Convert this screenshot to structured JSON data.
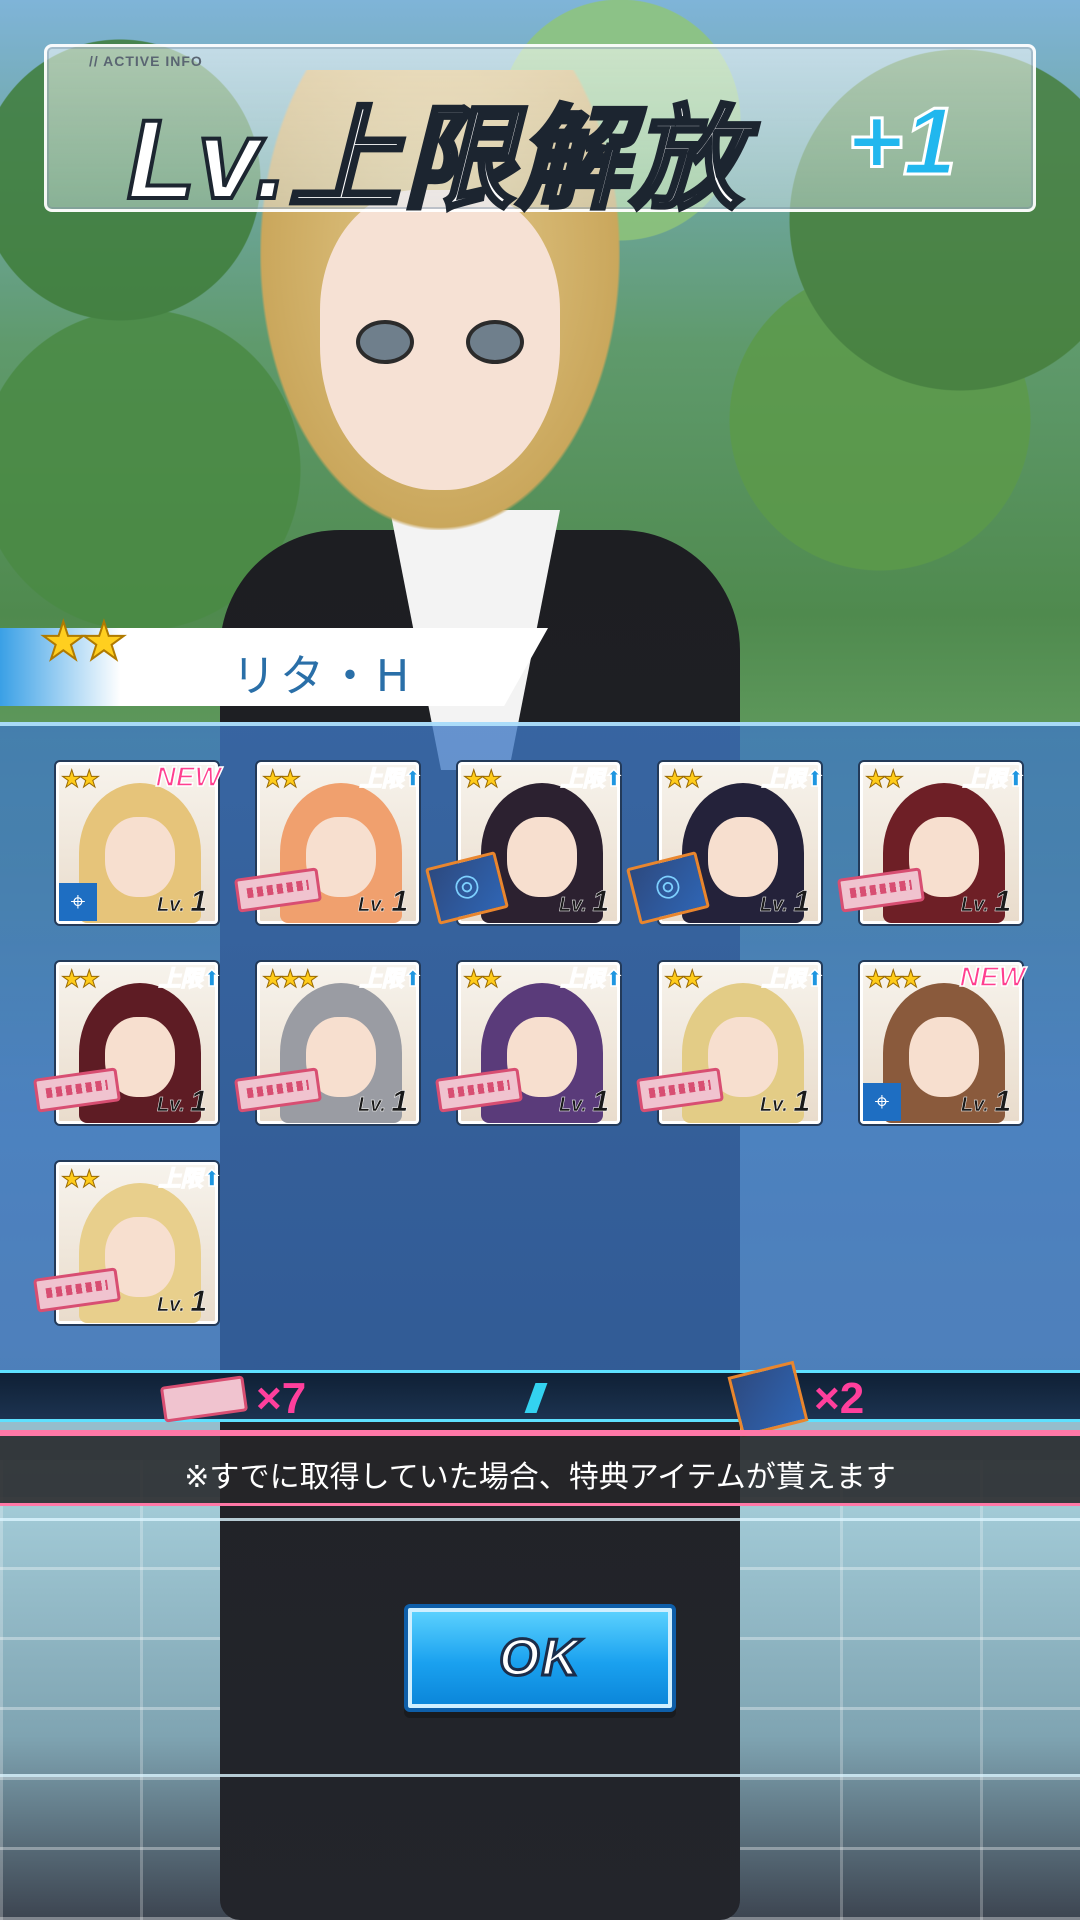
{
  "title": {
    "small_label": "// ACTIVE INFO",
    "main": "Lv.上限解放",
    "plus": "+1"
  },
  "character": {
    "name": "リタ・H",
    "stars": "★★"
  },
  "cards": [
    {
      "stars": "★★",
      "badge": "NEW",
      "badge_type": "new",
      "level_prefix": "Lv.",
      "level": "1",
      "item": "side-icon",
      "hair": "#e6c47a"
    },
    {
      "stars": "★★",
      "badge": "上限⬆",
      "badge_type": "up",
      "level_prefix": "Lv.",
      "level": "1",
      "item": "ticket",
      "hair": "#f0a06e"
    },
    {
      "stars": "★★",
      "badge": "上限⬆",
      "badge_type": "up",
      "level_prefix": "Lv.",
      "level": "1",
      "item": "book",
      "hair": "#2c2130"
    },
    {
      "stars": "★★",
      "badge": "上限⬆",
      "badge_type": "up",
      "level_prefix": "Lv.",
      "level": "1",
      "item": "book",
      "hair": "#24223a"
    },
    {
      "stars": "★★",
      "badge": "上限⬆",
      "badge_type": "up",
      "level_prefix": "Lv.",
      "level": "1",
      "item": "ticket",
      "hair": "#6e1f26"
    },
    {
      "stars": "★★",
      "badge": "上限⬆",
      "badge_type": "up",
      "level_prefix": "Lv.",
      "level": "1",
      "item": "ticket",
      "hair": "#5e1c24"
    },
    {
      "stars": "★★★",
      "badge": "上限⬆",
      "badge_type": "up",
      "level_prefix": "Lv.",
      "level": "1",
      "item": "ticket",
      "hair": "#9a9ca3"
    },
    {
      "stars": "★★",
      "badge": "上限⬆",
      "badge_type": "up",
      "level_prefix": "Lv.",
      "level": "1",
      "item": "ticket",
      "hair": "#5a3b7a"
    },
    {
      "stars": "★★",
      "badge": "上限⬆",
      "badge_type": "up",
      "level_prefix": "Lv.",
      "level": "1",
      "item": "ticket",
      "hair": "#e3cc86"
    },
    {
      "stars": "★★★",
      "badge": "NEW",
      "badge_type": "new",
      "level_prefix": "Lv.",
      "level": "1",
      "item": "side-icon",
      "hair": "#8a5a3c"
    },
    {
      "stars": "★★",
      "badge": "上限⬆",
      "badge_type": "up",
      "level_prefix": "Lv.",
      "level": "1",
      "item": "ticket",
      "hair": "#e8cf8c"
    }
  ],
  "rewards": {
    "ticket_count": "×7",
    "book_count": "×2"
  },
  "notice": "※すでに取得していた場合、特典アイテムが貰えます",
  "ok_button": "OK",
  "colors": {
    "accent_blue": "#1aa1ef",
    "accent_pink": "#ff3f9c",
    "panel_blue": "#3e78c4"
  }
}
